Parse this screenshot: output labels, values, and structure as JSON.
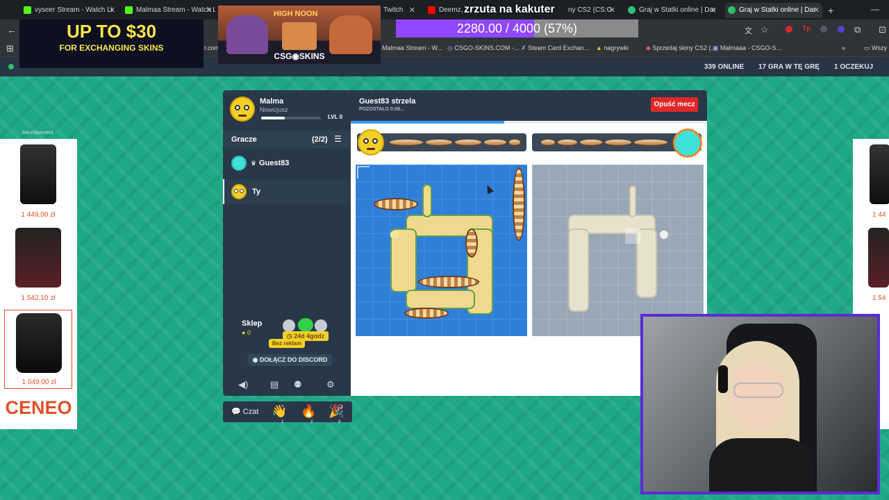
{
  "browser": {
    "tabs": [
      {
        "label": "vyseer Stream - Watch Li",
        "active": false
      },
      {
        "label": "Malmaa Stream - Watch L",
        "active": false
      },
      {
        "label": "Twitch",
        "active": false
      },
      {
        "label": "Deemz, Sz",
        "active": false
      },
      {
        "label": "ny CS2 (CS:G",
        "active": false
      },
      {
        "label": "Graj w Statki online | Dar",
        "active": false
      },
      {
        "label": "Graj w Statki online | Dar",
        "active": true
      }
    ],
    "new_tab": "+",
    "bookmarks": [
      "r.com",
      "Malmaa Stream - W...",
      "CSGO-SKINS.COM -...",
      "Steam Card Exchan...",
      "nagrywki",
      "Sprzedaj skiny CS2 (...",
      "Malmaaa - CSGO-S...",
      "Wszy"
    ]
  },
  "site_header": {
    "online": "339 ONLINE",
    "playing": "17 GRA W TĘ GRĘ",
    "waiting": "1 OCZEKUJ"
  },
  "overlays": {
    "stream_title": "zrzuta na kakuter",
    "sub_goal": {
      "text": "2280.00 / 4000 (57%)",
      "progress": 0.57
    },
    "ad_skins": {
      "headline": "UP TO $30",
      "sub": "FOR EXCHANGING SKINS"
    },
    "ad_highnoon": {
      "headline": "HIGH NOON",
      "brand": "CSG◉SKINS"
    }
  },
  "side_ad": {
    "label": "Advertisement",
    "products": [
      {
        "price": "1 449,00 zł"
      },
      {
        "price": "1 542,10 zł"
      },
      {
        "price": "1 049,00 zł"
      }
    ],
    "brand": "CENEO",
    "right_prices": [
      "1 44",
      "1 54"
    ]
  },
  "game": {
    "user": {
      "name": "Malma",
      "rank": "Nowicjusz",
      "level": "LVL 0",
      "level_progress": 0.4
    },
    "players_header": {
      "label": "Gracze",
      "count": "(2/2)"
    },
    "players": [
      {
        "name": "Guest83",
        "crown": "♛"
      },
      {
        "name": "Ty"
      }
    ],
    "shop": {
      "label": "Sklep",
      "coins": "0",
      "timer": "24d 4godz",
      "no_ads": "Bez reklam"
    },
    "discord_button": "DOŁĄCZ DO DISCORD",
    "status": {
      "turn": "Guest83 strzela",
      "remaining": "POZOSTAŁO 0:09..."
    },
    "exit_button": "Opuść mecz",
    "turn_timer_progress": 0.43
  },
  "chat": {
    "label": "Czat",
    "emotes": [
      {
        "glyph": "👋",
        "key": "1"
      },
      {
        "glyph": "🔥",
        "key": "2"
      },
      {
        "glyph": "🎉",
        "key": "3"
      }
    ]
  },
  "icons": [
    "back-arrow-icon",
    "apps-grid-icon",
    "translate-icon",
    "star-icon",
    "extensions-icon",
    "settings-sliders-icon",
    "volume-icon",
    "book-icon",
    "people-icon",
    "gear-icon",
    "chat-icon",
    "crown-icon",
    "coin-icon",
    "discord-icon"
  ],
  "colors": {
    "accent_exit": "#e0282a",
    "panel": "#283848",
    "sea": "#2f7fd9",
    "fog": "#9aa7b6",
    "timer": "#3a9cf0",
    "sub_goal": "#9147ff"
  }
}
